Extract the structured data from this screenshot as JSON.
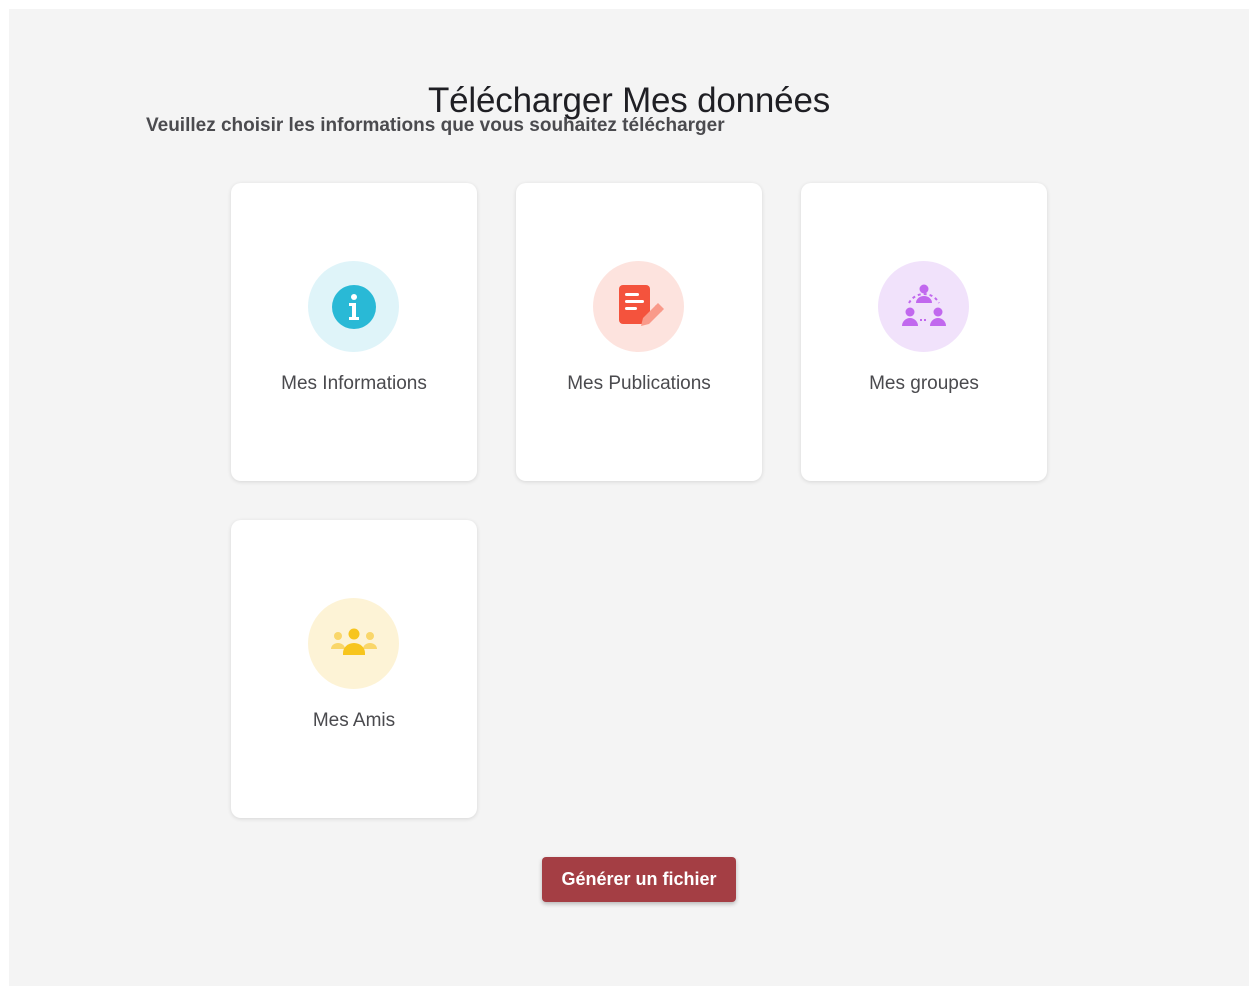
{
  "header": {
    "title": "Télécharger Mes données",
    "subtitle": "Veuillez choisir les informations que vous souhaitez télécharger"
  },
  "cards": [
    {
      "label": "Mes Informations",
      "icon": "info-icon",
      "bg": "#dff4f9",
      "accent": "#29b9d6"
    },
    {
      "label": "Mes Publications",
      "icon": "document-edit-icon",
      "bg": "#fde3de",
      "accent": "#f4533d"
    },
    {
      "label": "Mes groupes",
      "icon": "group-network-icon",
      "bg": "#f1e2fb",
      "accent": "#c168ee"
    },
    {
      "label": "Mes Amis",
      "icon": "friends-icon",
      "bg": "#fdf3d6",
      "accent": "#f7c51e"
    }
  ],
  "actions": {
    "generate_label": "Générer un fichier"
  }
}
